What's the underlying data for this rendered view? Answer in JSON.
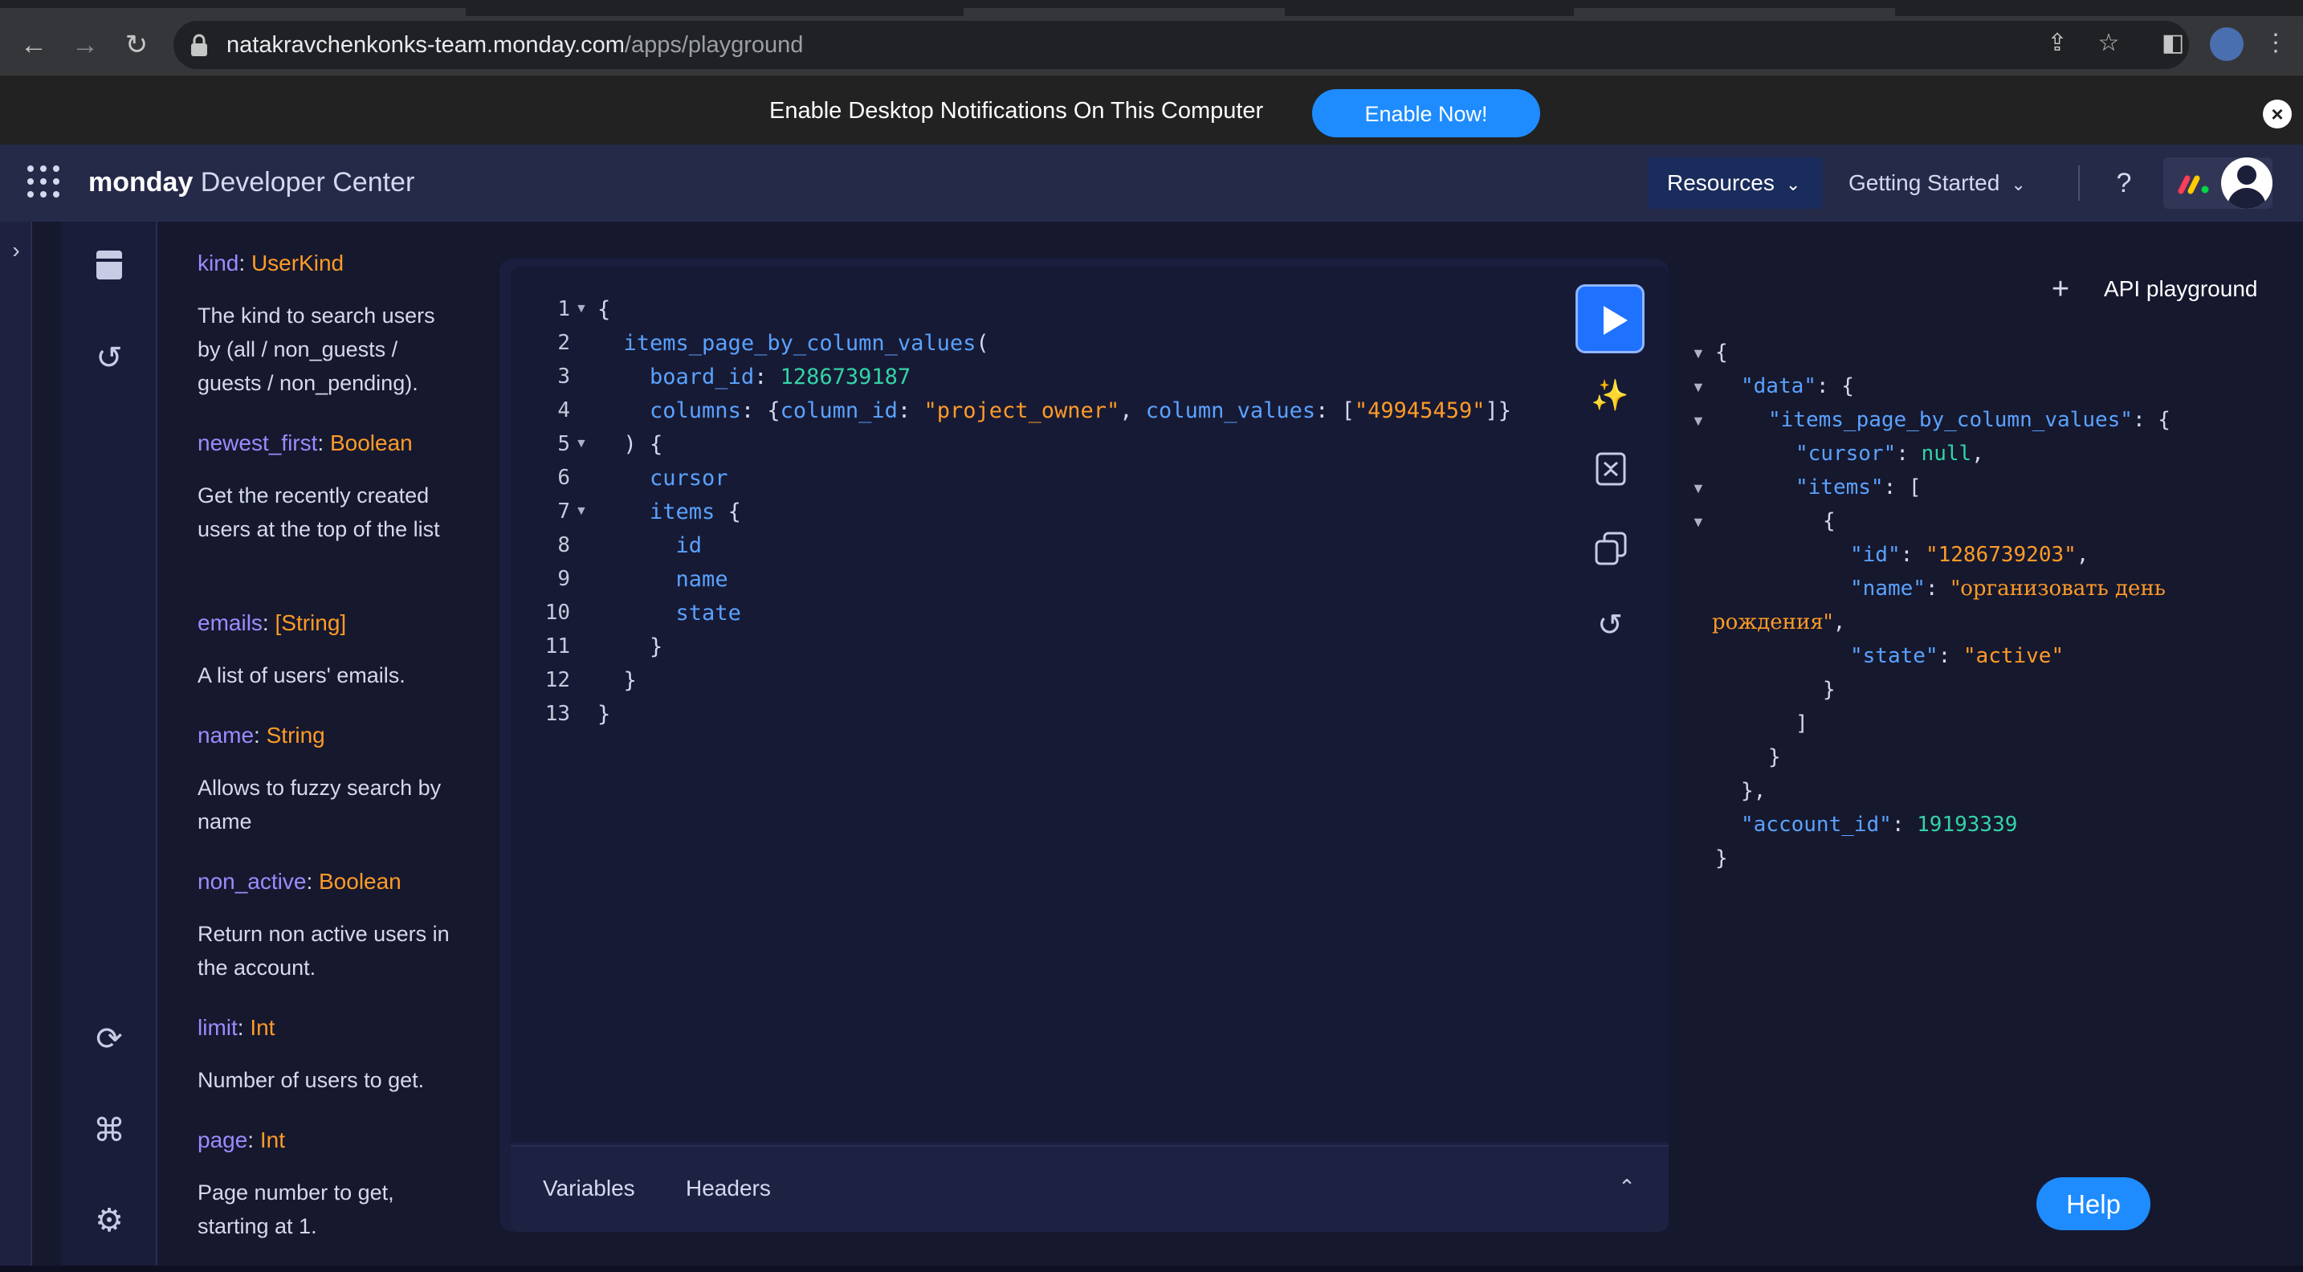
{
  "browser": {
    "url_host": "natakravchenkonks-team.monday.com",
    "url_path": "/apps/playground",
    "icons": [
      "back-arrow-icon",
      "forward-arrow-icon",
      "reload-icon",
      "lock-icon",
      "share-icon",
      "star-icon",
      "side-panel-icon",
      "profile-icon",
      "kebab-menu-icon"
    ]
  },
  "notification": {
    "text": "Enable Desktop Notifications On This Computer",
    "button": "Enable Now!"
  },
  "header": {
    "brand_bold": "monday",
    "brand_rest": " Developer Center",
    "resources": "Resources",
    "getting_started": "Getting Started",
    "help_mark": "?"
  },
  "docs": [
    {
      "name": "kind",
      "type": "UserKind",
      "desc": "The kind to search users by (all / non_guests / guests / non_pending)."
    },
    {
      "name": "newest_first",
      "type": "Boolean",
      "desc": "Get the recently created users at the top of the list"
    },
    {
      "name": "emails",
      "type": "[String]",
      "desc": "A list of users' emails."
    },
    {
      "name": "name",
      "type": "String",
      "desc": "Allows to fuzzy search by name"
    },
    {
      "name": "non_active",
      "type": "Boolean",
      "desc": "Return non active users in the account."
    },
    {
      "name": "limit",
      "type": "Int",
      "desc": "Number of users to get."
    },
    {
      "name": "page",
      "type": "Int",
      "desc": "Page number to get, starting at 1."
    }
  ],
  "editor": {
    "line_numbers": [
      "1",
      "2",
      "3",
      "4",
      "5",
      "6",
      "7",
      "8",
      "9",
      "10",
      "11",
      "12",
      "13"
    ],
    "fn_name": "items_page_by_column_values",
    "board_key": "board_id",
    "board_val": "1286739187",
    "columns_key": "columns",
    "column_id_key": "column_id",
    "column_id_val": "\"project_owner\"",
    "column_values_key": "column_values",
    "column_values_val": "\"49945459\"",
    "fields": [
      "cursor",
      "items",
      "id",
      "name",
      "state"
    ],
    "tabs": {
      "variables": "Variables",
      "headers": "Headers"
    }
  },
  "results": {
    "tab_label": "API playground",
    "add": "+",
    "keys": {
      "data": "\"data\"",
      "ipbcv": "\"items_page_by_column_values\"",
      "cursor": "\"cursor\"",
      "items": "\"items\"",
      "id": "\"id\"",
      "name": "\"name\"",
      "state": "\"state\"",
      "account_id": "\"account_id\""
    },
    "values": {
      "cursor": "null",
      "id": "\"1286739203\"",
      "name_part1": "\"организовать день",
      "name_part2": "рождения\"",
      "state": "\"active\"",
      "account_id": "19193339"
    }
  },
  "help_button": "Help"
}
